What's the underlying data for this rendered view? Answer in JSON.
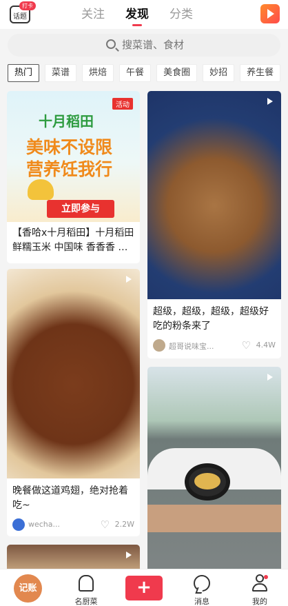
{
  "header": {
    "topic_label": "话题",
    "topic_badge": "打卡",
    "tabs": [
      "关注",
      "发现",
      "分类"
    ],
    "active_tab": "发现"
  },
  "search": {
    "placeholder": "搜菜谱、食材"
  },
  "categories": [
    "热门",
    "菜谱",
    "烘焙",
    "午餐",
    "美食圈",
    "妙招",
    "养生餐"
  ],
  "feed": {
    "ad": {
      "tag": "活动",
      "brand": "十月稻田",
      "line1": "美味不设限",
      "line2": "营养饪我行",
      "cta": "立即参与",
      "title": "【香哈x十月稻田】十月稻田鲜糯玉米 中国味 香香香 …"
    },
    "noodles": {
      "title": "超级，超级，超级，超级好吃的粉条来了",
      "author": "超哥说味宝...",
      "likes": "4.4W"
    },
    "wings": {
      "title": "晚餐做这道鸡翅，绝对抢着吃~",
      "author": "wecha...",
      "likes": "2.2W"
    }
  },
  "bottom_nav": {
    "record": "记账",
    "chef": "名厨菜",
    "messages": "消息",
    "me": "我的"
  },
  "colors": {
    "accent": "#f03a4d",
    "record": "#e2884f"
  }
}
